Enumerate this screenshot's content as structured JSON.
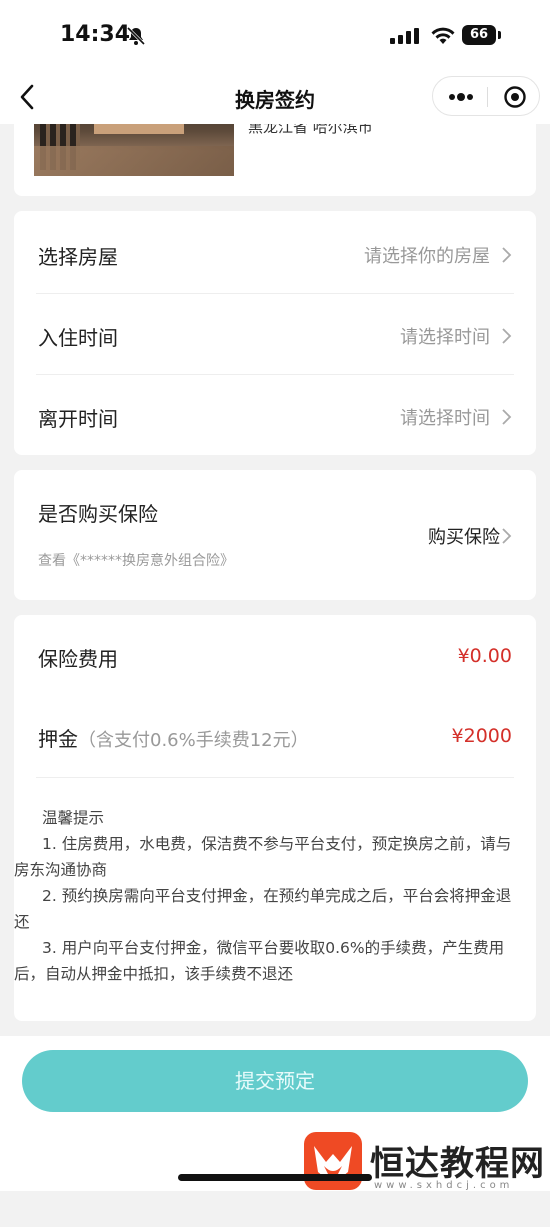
{
  "status_bar": {
    "time": "14:34",
    "battery": "66"
  },
  "nav": {
    "title": "换房签约"
  },
  "listing": {
    "location": "黑龙江省 哈尔滨市"
  },
  "form": {
    "rows": [
      {
        "label": "选择房屋",
        "value": "请选择你的房屋"
      },
      {
        "label": "入住时间",
        "value": "请选择时间"
      },
      {
        "label": "离开时间",
        "value": "请选择时间"
      }
    ]
  },
  "insurance": {
    "question": "是否购买保险",
    "policy_link": "查看《******换房意外组合险》",
    "action": "购买保险"
  },
  "fees": {
    "insurance_label": "保险费用",
    "insurance_value": "¥0.00",
    "deposit_label": "押金",
    "deposit_hint": "（含支付0.6%手续费12元）",
    "deposit_value": "¥2000"
  },
  "tips": {
    "title": "温馨提示",
    "items": [
      "1. 住房费用，水电费，保洁费不参与平台支付，预定换房之前，请与房东沟通协商",
      "2. 预约换房需向平台支付押金，在预约单完成之后，平台会将押金退还",
      "3. 用户向平台支付押金，微信平台要收取0.6%的手续费，产生费用后，自动从押金中抵扣，该手续费不退还"
    ]
  },
  "submit": {
    "label": "提交预定"
  },
  "watermark": {
    "name": "恒达教程网",
    "url": "www.sxhdcj.com"
  },
  "colors": {
    "accent": "#63cccc",
    "price": "#d4302a"
  }
}
